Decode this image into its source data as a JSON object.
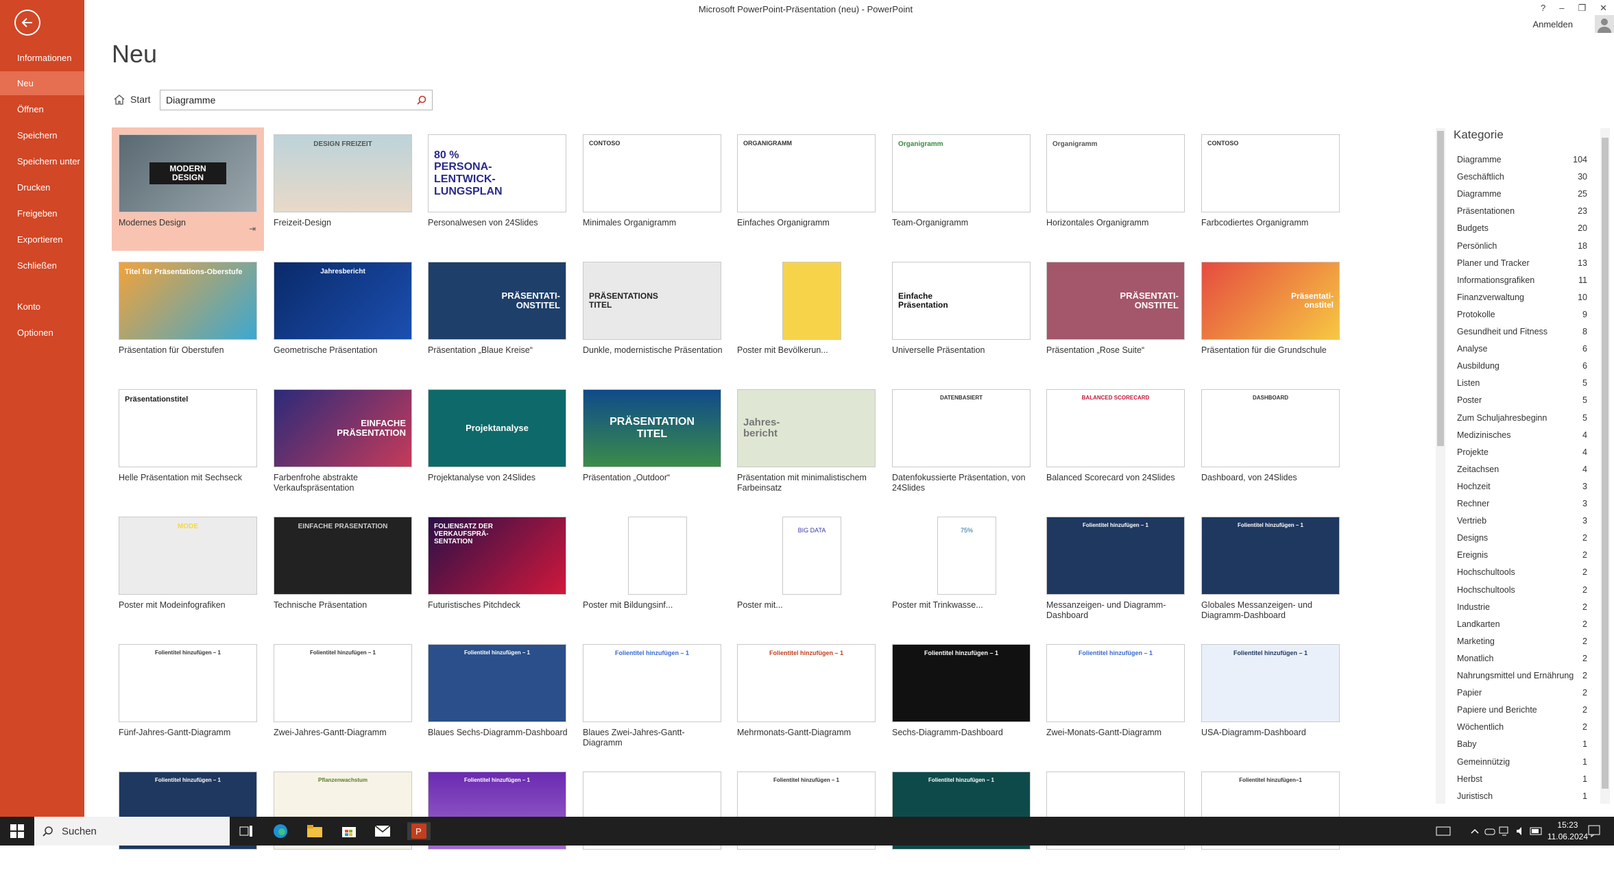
{
  "window": {
    "title": "Microsoft PowerPoint-Präsentation (neu) - PowerPoint",
    "help": "?",
    "minimize": "–",
    "restore": "❐",
    "close": "✕",
    "signin": "Anmelden"
  },
  "sidebar": {
    "items": [
      {
        "label": "Informationen"
      },
      {
        "label": "Neu"
      },
      {
        "label": "Öffnen"
      },
      {
        "label": "Speichern"
      },
      {
        "label": "Speichern unter"
      },
      {
        "label": "Drucken"
      },
      {
        "label": "Freigeben"
      },
      {
        "label": "Exportieren"
      },
      {
        "label": "Schließen"
      },
      {
        "label": "Konto"
      },
      {
        "label": "Optionen"
      }
    ]
  },
  "page": {
    "title": "Neu",
    "home_label": "Start",
    "search_value": "Diagramme"
  },
  "templates": [
    {
      "label": "Modernes Design",
      "thumb": "MODERN\nDESIGN"
    },
    {
      "label": "Freizeit-Design",
      "thumb": "DESIGN FREIZEIT"
    },
    {
      "label": "Personalwesen von 24Slides",
      "thumb": "80 %\nPERSONA-\nLENTWICK-\nLUNGSPLAN"
    },
    {
      "label": "Minimales Organigramm",
      "thumb": "CONTOSO"
    },
    {
      "label": "Einfaches Organigramm",
      "thumb": "ORGANIGRAMM"
    },
    {
      "label": "Team-Organigramm",
      "thumb": "Organigramm"
    },
    {
      "label": "Horizontales Organigramm",
      "thumb": "Organigramm"
    },
    {
      "label": "Farbcodiertes Organigramm",
      "thumb": "CONTOSO"
    },
    {
      "label": "Präsentation für Oberstufen",
      "thumb": "Titel für Präsentations-Oberstufe"
    },
    {
      "label": "Geometrische Präsentation",
      "thumb": "Jahresbericht"
    },
    {
      "label": "Präsentation „Blaue Kreise“",
      "thumb": "PRÄSENTATI-\nONSTITEL"
    },
    {
      "label": "Dunkle, modernistische Präsentation",
      "thumb": "PRÄSENTATIONS\nTITEL"
    },
    {
      "label": "Poster mit Bevölkerun...",
      "thumb": ""
    },
    {
      "label": "Universelle Präsentation",
      "thumb": "Einfache\nPräsentation"
    },
    {
      "label": "Präsentation „Rose Suite“",
      "thumb": "PRÄSENTATI-\nONSTITEL"
    },
    {
      "label": "Präsentation für die Grundschule",
      "thumb": "Präsentati-\nonstitel"
    },
    {
      "label": "Helle Präsentation mit Sechseck",
      "thumb": "Präsentationstitel"
    },
    {
      "label": "Farbenfrohe abstrakte Verkaufspräsentation",
      "thumb": "EINFACHE\nPRÄSENTATION"
    },
    {
      "label": "Projektanalyse von 24Slides",
      "thumb": "Projektanalyse"
    },
    {
      "label": "Präsentation „Outdoor“",
      "thumb": "PRÄSENTATION\nTITEL"
    },
    {
      "label": "Präsentation mit minimalistischem Farbeinsatz",
      "thumb": "Jahres-\nbericht"
    },
    {
      "label": "Datenfokussierte Präsentation, von 24Slides",
      "thumb": "DATENBASIERT"
    },
    {
      "label": "Balanced Scorecard von 24Slides",
      "thumb": "BALANCED SCORECARD"
    },
    {
      "label": "Dashboard, von 24Slides",
      "thumb": "DASHBOARD"
    },
    {
      "label": "Poster mit Modeinfografiken",
      "thumb": "MODE"
    },
    {
      "label": "Technische Präsentation",
      "thumb": "EINFACHE PRÄSENTATION"
    },
    {
      "label": "Futuristisches Pitchdeck",
      "thumb": "FOLIENSATZ DER\nVERKAUFSPRÄ-\nSENTATION"
    },
    {
      "label": "Poster mit Bildungsinf...",
      "thumb": ""
    },
    {
      "label": "Poster mit...",
      "thumb": "BIG DATA"
    },
    {
      "label": "Poster mit Trinkwasse...",
      "thumb": "75%"
    },
    {
      "label": "Messanzeigen- und Diagramm-Dashboard",
      "thumb": "Folientitel hinzufügen – 1"
    },
    {
      "label": "Globales Messanzeigen- und Diagramm-Dashboard",
      "thumb": "Folientitel hinzufügen – 1"
    },
    {
      "label": "Fünf-Jahres-Gantt-Diagramm",
      "thumb": "Folientitel hinzufügen – 1"
    },
    {
      "label": "Zwei-Jahres-Gantt-Diagramm",
      "thumb": "Folientitel hinzufügen – 1"
    },
    {
      "label": "Blaues Sechs-Diagramm-Dashboard",
      "thumb": "Folientitel hinzufügen – 1"
    },
    {
      "label": "Blaues Zwei-Jahres-Gantt-Diagramm",
      "thumb": "Folientitel hinzufügen – 1"
    },
    {
      "label": "Mehrmonats-Gantt-Diagramm",
      "thumb": "Folientitel hinzufügen – 1"
    },
    {
      "label": "Sechs-Diagramm-Dashboard",
      "thumb": "Folientitel hinzufügen – 1"
    },
    {
      "label": "Zwei-Monats-Gantt-Diagramm",
      "thumb": "Folientitel hinzufügen – 1"
    },
    {
      "label": "USA-Diagramm-Dashboard",
      "thumb": "Folientitel hinzufügen – 1"
    },
    {
      "label": "",
      "thumb": "Folientitel hinzufügen – 1"
    },
    {
      "label": "",
      "thumb": "Pflanzenwachstum"
    },
    {
      "label": "",
      "thumb": "Folientitel hinzufügen – 1"
    },
    {
      "label": "",
      "thumb": ""
    },
    {
      "label": "",
      "thumb": "Folientitel hinzufügen – 1"
    },
    {
      "label": "",
      "thumb": "Folientitel hinzufügen – 1"
    },
    {
      "label": "",
      "thumb": ""
    },
    {
      "label": "",
      "thumb": "Folientitel hinzufügen–1"
    }
  ],
  "categories": {
    "title": "Kategorie",
    "items": [
      {
        "name": "Diagramme",
        "count": "104"
      },
      {
        "name": "Geschäftlich",
        "count": "30"
      },
      {
        "name": "Diagramme",
        "count": "25"
      },
      {
        "name": "Präsentationen",
        "count": "23"
      },
      {
        "name": "Budgets",
        "count": "20"
      },
      {
        "name": "Persönlich",
        "count": "18"
      },
      {
        "name": "Planer und Tracker",
        "count": "13"
      },
      {
        "name": "Informationsgrafiken",
        "count": "11"
      },
      {
        "name": "Finanzverwaltung",
        "count": "10"
      },
      {
        "name": "Protokolle",
        "count": "9"
      },
      {
        "name": "Gesundheit und Fitness",
        "count": "8"
      },
      {
        "name": "Analyse",
        "count": "6"
      },
      {
        "name": "Ausbildung",
        "count": "6"
      },
      {
        "name": "Listen",
        "count": "5"
      },
      {
        "name": "Poster",
        "count": "5"
      },
      {
        "name": "Zum Schuljahresbeginn",
        "count": "5"
      },
      {
        "name": "Medizinisches",
        "count": "4"
      },
      {
        "name": "Projekte",
        "count": "4"
      },
      {
        "name": "Zeitachsen",
        "count": "4"
      },
      {
        "name": "Hochzeit",
        "count": "3"
      },
      {
        "name": "Rechner",
        "count": "3"
      },
      {
        "name": "Vertrieb",
        "count": "3"
      },
      {
        "name": "Designs",
        "count": "2"
      },
      {
        "name": "Ereignis",
        "count": "2"
      },
      {
        "name": "Hochschultools",
        "count": "2"
      },
      {
        "name": "Hochschultools",
        "count": "2"
      },
      {
        "name": "Industrie",
        "count": "2"
      },
      {
        "name": "Landkarten",
        "count": "2"
      },
      {
        "name": "Marketing",
        "count": "2"
      },
      {
        "name": "Monatlich",
        "count": "2"
      },
      {
        "name": "Nahrungsmittel und Ernährung",
        "count": "2"
      },
      {
        "name": "Papier",
        "count": "2"
      },
      {
        "name": "Papiere und Berichte",
        "count": "2"
      },
      {
        "name": "Wöchentlich",
        "count": "2"
      },
      {
        "name": "Baby",
        "count": "1"
      },
      {
        "name": "Gemeinnützig",
        "count": "1"
      },
      {
        "name": "Herbst",
        "count": "1"
      },
      {
        "name": "Juristisch",
        "count": "1"
      }
    ]
  },
  "taskbar": {
    "search_label": "Suchen",
    "time": "15:23",
    "date": "11.06.2024"
  }
}
